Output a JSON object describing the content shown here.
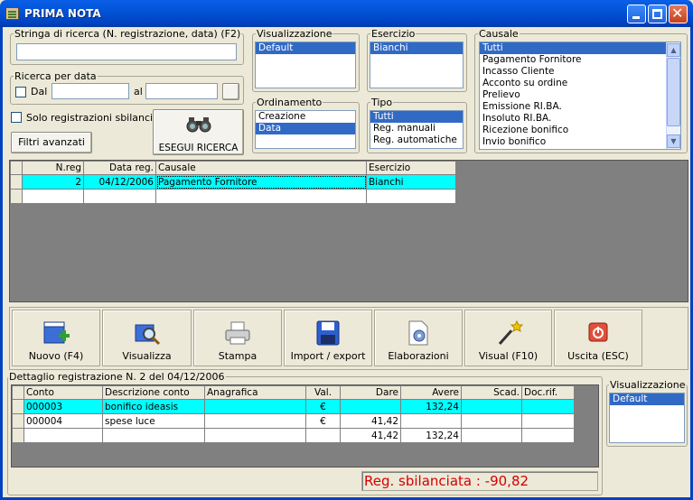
{
  "window": {
    "title": "PRIMA NOTA"
  },
  "search": {
    "string_legend": "Stringa di ricerca (N. registrazione, data) (F2)",
    "string_value": "",
    "date_legend": "Ricerca per data",
    "dal_label": "Dal",
    "al_label": "al",
    "dal_value": "",
    "al_value": "",
    "unbalanced_label": "Solo registrazioni sbilanciate",
    "advanced_filters": "Filtri avanzati",
    "execute": "ESEGUI RICERCA"
  },
  "visualizzazione": {
    "legend": "Visualizzazione",
    "items": [
      "Default"
    ]
  },
  "esercizio": {
    "legend": "Esercizio",
    "items": [
      "Bianchi"
    ]
  },
  "ordinamento": {
    "legend": "Ordinamento",
    "items": [
      "Creazione",
      "Data"
    ],
    "selected": "Data"
  },
  "tipo": {
    "legend": "Tipo",
    "items": [
      "Tutti",
      "Reg. manuali",
      "Reg. automatiche"
    ],
    "selected": "Tutti"
  },
  "causale": {
    "legend": "Causale",
    "items": [
      "Tutti",
      "Pagamento Fornitore",
      "Incasso Cliente",
      "Acconto su ordine",
      "Prelievo",
      "Emissione RI.BA.",
      "Insoluto RI.BA.",
      "Ricezione bonifico",
      "Invio bonifico"
    ],
    "selected": "Tutti"
  },
  "results": {
    "columns": [
      "N.reg",
      "Data reg.",
      "Causale",
      "Esercizio"
    ],
    "rows": [
      [
        "2",
        "04/12/2006",
        "Pagamento Fornitore",
        "Bianchi"
      ]
    ]
  },
  "toolbar": {
    "nuovo": "Nuovo (F4)",
    "visualizza": "Visualizza",
    "stampa": "Stampa",
    "import_export": "Import / export",
    "elaborazioni": "Elaborazioni",
    "visual": "Visual (F10)",
    "uscita": "Uscita (ESC)"
  },
  "detail": {
    "legend": "Dettaglio registrazione N. 2 del 04/12/2006",
    "columns": [
      "Conto",
      "Descrizione conto",
      "Anagrafica",
      "Val.",
      "Dare",
      "Avere",
      "Scad.",
      "Doc.rif."
    ],
    "rows": [
      [
        "000003",
        "bonifico ideasis",
        "",
        "€",
        "",
        "132,24",
        "",
        ""
      ],
      [
        "000004",
        "spese luce",
        "",
        "€",
        "41,42",
        "",
        "",
        ""
      ]
    ],
    "totals": {
      "dare": "41,42",
      "avere": "132,24"
    },
    "status": "Reg. sbilanciata : -90,82"
  },
  "detail_view": {
    "legend": "Visualizzazione",
    "items": [
      "Default"
    ]
  },
  "colors": {
    "selection": "#316ac5",
    "row_highlight": "#00ffff",
    "status_red": "#d40000"
  }
}
